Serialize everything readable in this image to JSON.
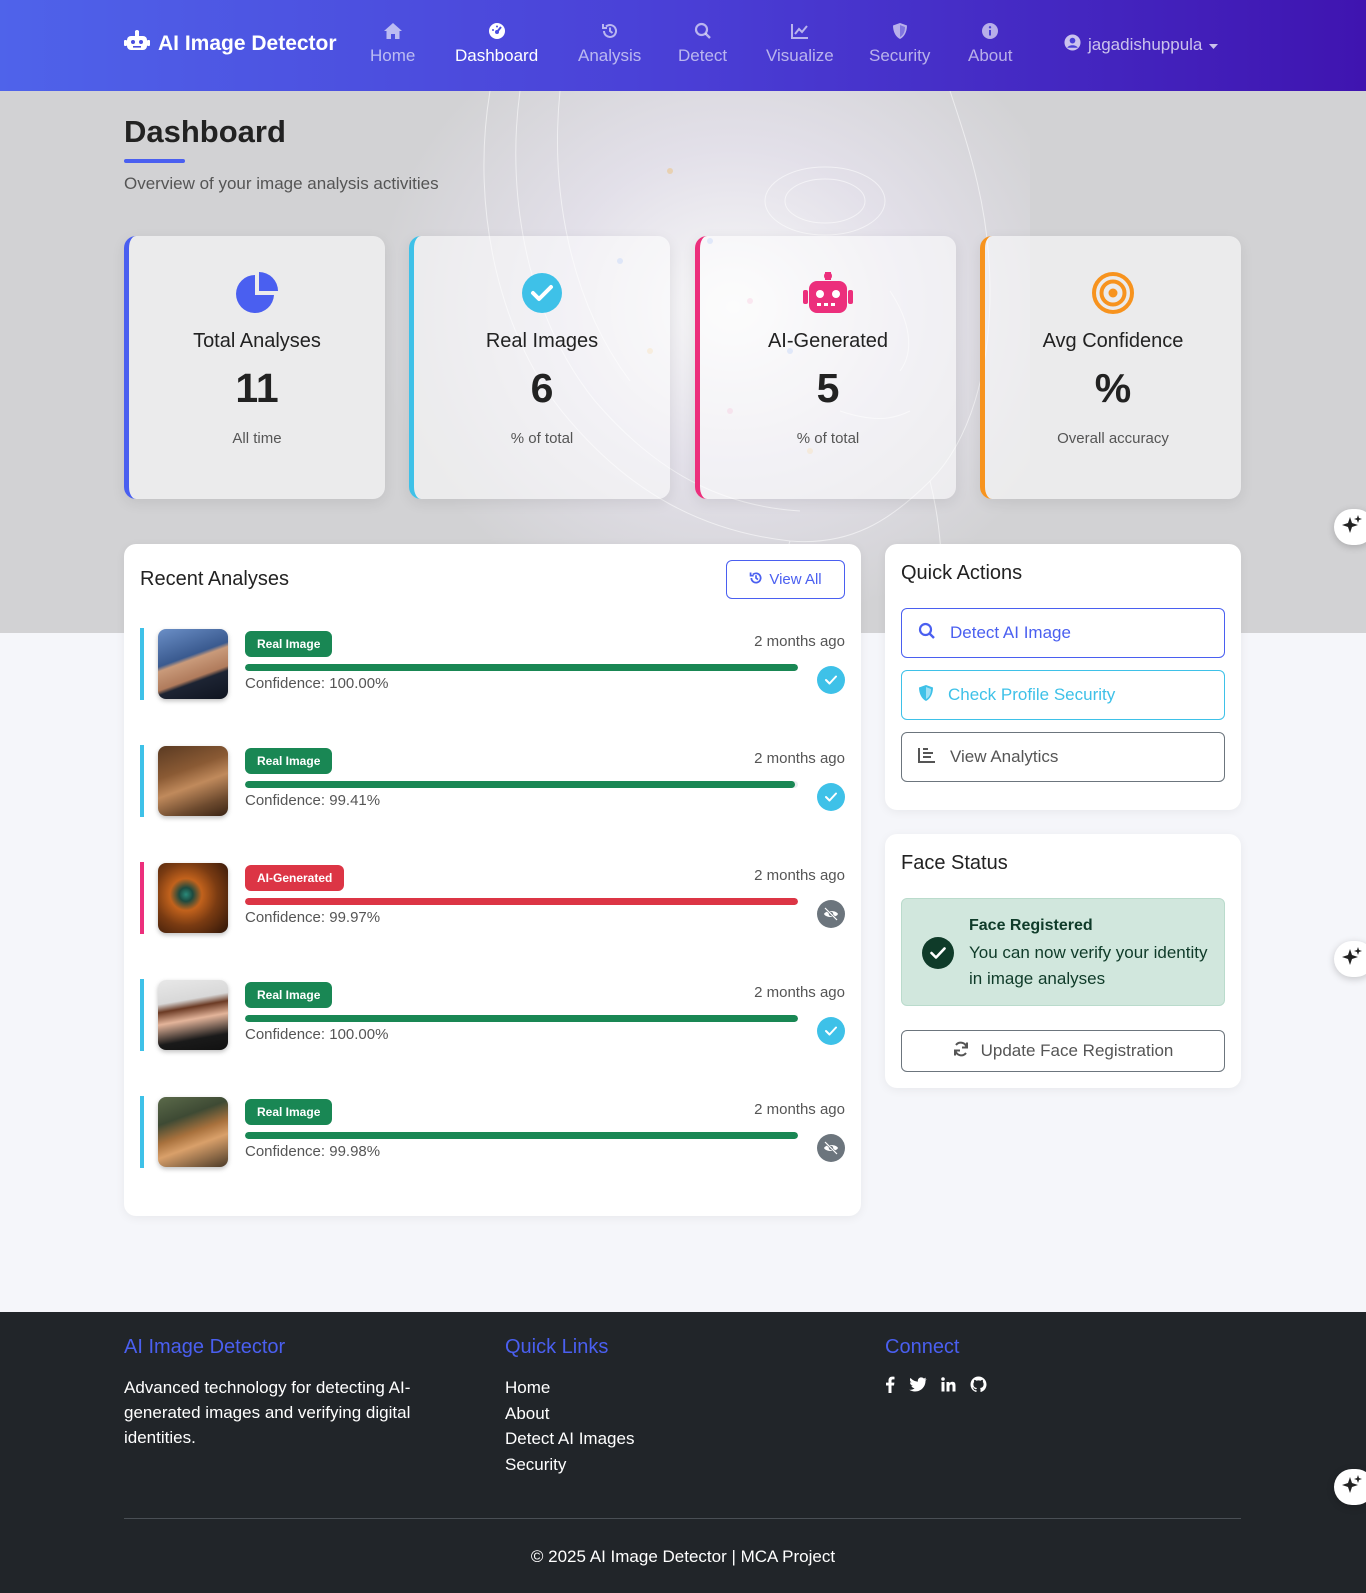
{
  "navbar": {
    "brand": "AI Image Detector",
    "items": [
      {
        "label": "Home",
        "icon": "home-icon"
      },
      {
        "label": "Dashboard",
        "icon": "dashboard-icon"
      },
      {
        "label": "Analysis",
        "icon": "history-icon"
      },
      {
        "label": "Detect",
        "icon": "search-icon"
      },
      {
        "label": "Visualize",
        "icon": "chart-line-icon"
      },
      {
        "label": "Security",
        "icon": "shield-icon"
      },
      {
        "label": "About",
        "icon": "info-icon"
      }
    ],
    "active": "Dashboard",
    "user": "jagadishuppula"
  },
  "header": {
    "title": "Dashboard",
    "subtitle": "Overview of your image analysis activities"
  },
  "stats": [
    {
      "label": "Total Analyses",
      "value": "11",
      "note": "All time",
      "color": "#4a5ff0",
      "icon": "pie-chart-icon"
    },
    {
      "label": "Real Images",
      "value": "6",
      "note": "% of total",
      "color": "#3ec1e8",
      "icon": "check-circle-icon"
    },
    {
      "label": "AI-Generated",
      "value": "5",
      "note": "% of total",
      "color": "#ec2f7c",
      "icon": "robot-icon"
    },
    {
      "label": "Avg Confidence",
      "value": "%",
      "note": "Overall accuracy",
      "color": "#f7931e",
      "icon": "target-icon"
    }
  ],
  "recent": {
    "title": "Recent Analyses",
    "view_all": "View All",
    "items": [
      {
        "badge": "Real Image",
        "type": "real",
        "time": "2 months ago",
        "confidence": "Confidence: 100.00%",
        "fill": 100,
        "status": "verified"
      },
      {
        "badge": "Real Image",
        "type": "real",
        "time": "2 months ago",
        "confidence": "Confidence: 99.41%",
        "fill": 99.41,
        "status": "verified"
      },
      {
        "badge": "AI-Generated",
        "type": "ai",
        "time": "2 months ago",
        "confidence": "Confidence: 99.97%",
        "fill": 100,
        "status": "hidden"
      },
      {
        "badge": "Real Image",
        "type": "real",
        "time": "2 months ago",
        "confidence": "Confidence: 100.00%",
        "fill": 100,
        "status": "verified"
      },
      {
        "badge": "Real Image",
        "type": "real",
        "time": "2 months ago",
        "confidence": "Confidence: 99.98%",
        "fill": 100,
        "status": "hidden"
      }
    ]
  },
  "quick_actions": {
    "title": "Quick Actions",
    "detect": "Detect AI Image",
    "security": "Check Profile Security",
    "analytics": "View Analytics"
  },
  "face_status": {
    "title": "Face Status",
    "status_title": "Face Registered",
    "status_text": "You can now verify your identity in image analyses",
    "update": "Update Face Registration"
  },
  "footer": {
    "brand_title": "AI Image Detector",
    "brand_text": "Advanced technology for detecting AI-generated images and verifying digital identities.",
    "links_title": "Quick Links",
    "links": [
      "Home",
      "About",
      "Detect AI Images",
      "Security"
    ],
    "connect_title": "Connect",
    "social": [
      "facebook-icon",
      "twitter-icon",
      "linkedin-icon",
      "github-icon"
    ],
    "copyright": "© 2025 AI Image Detector | MCA Project"
  },
  "colors": {
    "primary": "#4a5ff0",
    "real": "#198754",
    "ai": "#dc3545",
    "info": "#3ec1e8",
    "pink": "#ec2f7c",
    "orange": "#f7931e"
  }
}
